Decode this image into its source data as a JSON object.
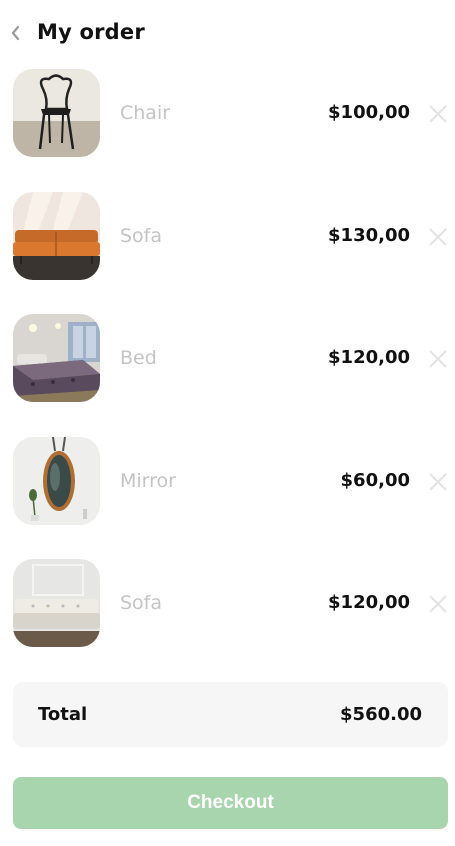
{
  "header": {
    "back_icon": "chevron-left-icon",
    "title": "My order"
  },
  "items": [
    {
      "name": "Chair",
      "price": "$100,00",
      "remove_icon": "close-icon"
    },
    {
      "name": "Sofa",
      "price": "$130,00",
      "remove_icon": "close-icon"
    },
    {
      "name": "Bed",
      "price": "$120,00",
      "remove_icon": "close-icon"
    },
    {
      "name": "Mirror",
      "price": "$60,00",
      "remove_icon": "close-icon"
    },
    {
      "name": "Sofa",
      "price": "$120,00",
      "remove_icon": "close-icon"
    }
  ],
  "total": {
    "label": "Total",
    "value": "$560.00"
  },
  "checkout": {
    "label": "Checkout"
  },
  "colors": {
    "checkout_bg": "#a9d5ae",
    "muted_text": "#c4c4c4",
    "total_bg": "#f6f6f6"
  }
}
